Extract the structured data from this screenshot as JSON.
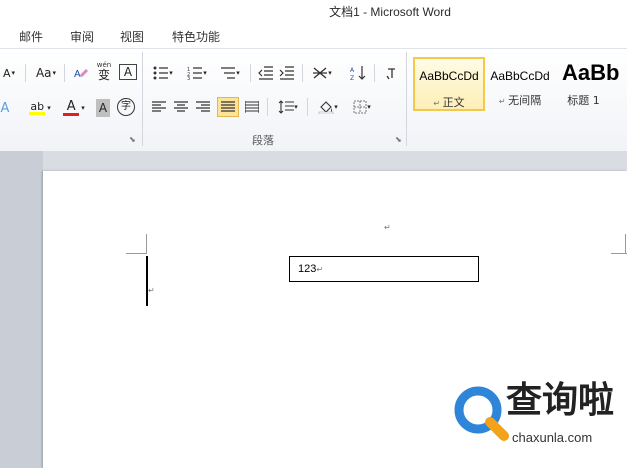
{
  "window": {
    "title": "文档1 - Microsoft Word"
  },
  "menu": {
    "tabs": [
      "邮件",
      "审阅",
      "视图",
      "特色功能"
    ]
  },
  "ribbon": {
    "font_tools": {
      "shrink_icon": "A",
      "change_case": "Aa",
      "phonetic_top": "wén",
      "phonetic": "变",
      "border_char": "A",
      "highlight": "ab",
      "font_color": "A",
      "shading": "A",
      "enclose": "字"
    },
    "paragraph_group_label": "段落",
    "styles": [
      {
        "sample": "AaBbCcDd",
        "name": "正文",
        "selected": true
      },
      {
        "sample": "AaBbCcDd",
        "name": "无间隔",
        "selected": false
      },
      {
        "sample": "AaBb",
        "name": "标题 1",
        "selected": false
      }
    ]
  },
  "document": {
    "textbox_text": "123"
  },
  "watermark": {
    "logo_text": "查询啦",
    "url": "chaxunla.com"
  },
  "colors": {
    "highlight_yellow": "#ffff00",
    "font_red": "#e02020",
    "logo_blue": "#2f86d8",
    "logo_orange": "#f3a21c",
    "selected_style_border": "#f2c94c"
  }
}
